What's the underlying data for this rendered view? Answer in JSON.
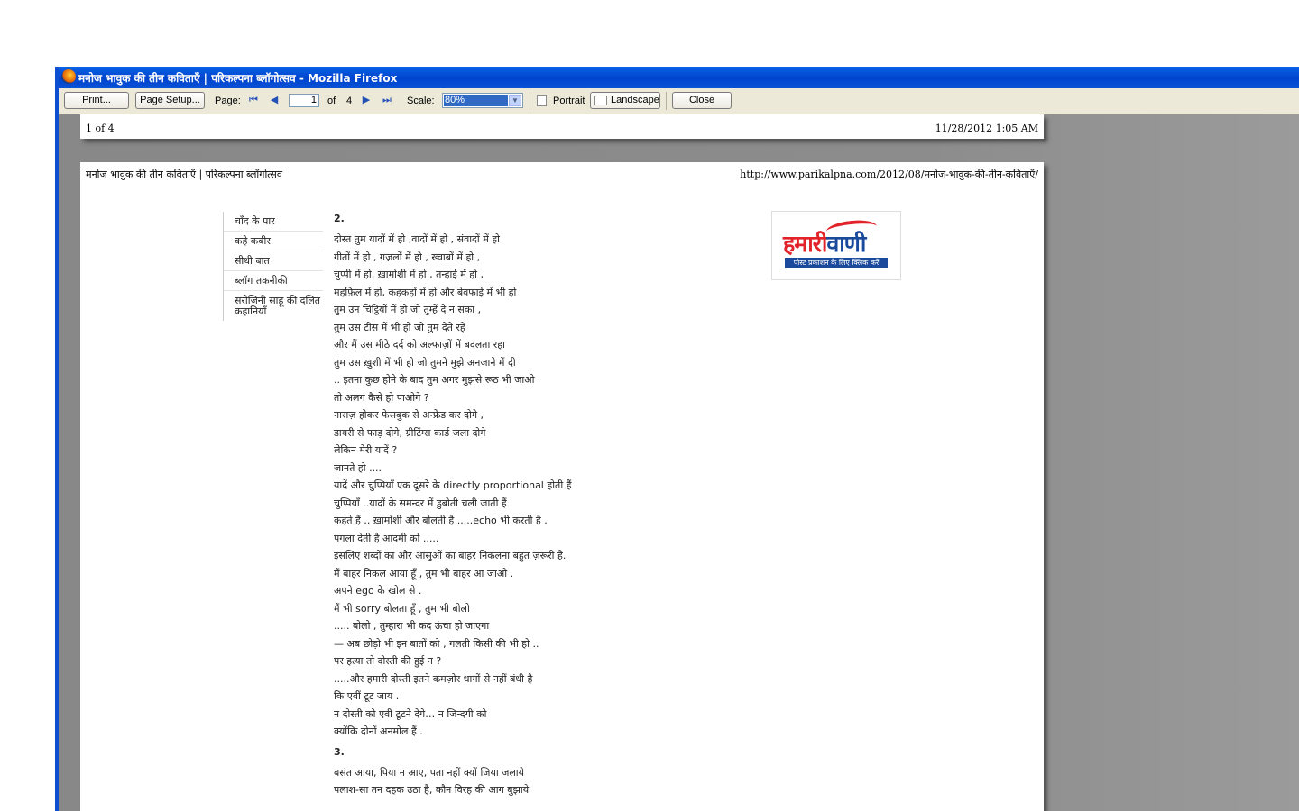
{
  "window": {
    "title": "मनोज भावुक की तीन कविताएँ | परिकल्पना ब्लॉगोत्सव - Mozilla Firefox"
  },
  "toolbar": {
    "print_label": "Print...",
    "page_setup_label": "Page Setup...",
    "page_label": "Page:",
    "page_value": "1",
    "of_label": "of",
    "page_total": "4",
    "scale_label": "Scale:",
    "scale_value": "80%",
    "portrait_label": "Portrait",
    "landscape_label": "Landscape",
    "close_label": "Close",
    "icons": [
      "first-page-icon",
      "previous-page-icon",
      "next-page-icon",
      "last-page-icon",
      "dropdown-arrow-icon",
      "portrait-icon",
      "landscape-icon"
    ]
  },
  "print_header": {
    "left": "1 of 4",
    "right": "11/28/2012 1:05 AM"
  },
  "page": {
    "title": "मनोज भावुक की तीन कविताएँ | परिकल्पना ब्लॉगोत्सव",
    "url": "http://www.parikalpna.com/2012/08/मनोज-भावुक-की-तीन-कविताएँ/",
    "sidebar": [
      {
        "label": "चाँद के पार"
      },
      {
        "label": "कहे कबीर"
      },
      {
        "label": "सीधी बात"
      },
      {
        "label": "ब्लॉग तकनीकी"
      },
      {
        "label": "सरोजिनी साहू की दलित कहानियाँ"
      }
    ],
    "poem_2_number": "2.",
    "poem_2_lines": [
      "दोस्त तुम यादों में हो ,वादों में हो , संवादों में हो",
      "गीतों में हो , ग़ज़लों में हो , ख्वाबों में हो ,",
      "चुप्पी में हो, ख़ामोशी में हो , तन्हाई में हो ,",
      "महफ़िल में हो, कहकहों में हो और बेवफाई में भी हो",
      "तुम उन चिट्ठियों में हो जो तुम्हें दे न सका ,",
      "तुम उस टीस में भी हो जो तुम देते रहे",
      "और मैं उस मीठे दर्द को अल्फाज़ों में बदलता रहा",
      "तुम उस ख़ुशी में भी हो जो तुमने मुझे अनजाने में दी",
      ".. इतना कुछ होने के बाद तुम अगर मुझसे रूठ भी जाओ",
      "तो अलग कैसे हो पाओगे ?",
      "नाराज़ होकर फेसबुक से अन्फ्रेंड कर दोगे ,",
      "डायरी से फाड़ दोगे, ग्रीटिंग्स कार्ड जला दोगे",
      "लेकिन मेरी यादें ?",
      "जानते हो ....",
      "यादें और चुप्पियाँ एक दूसरे के directly proportional होती हैं",
      "चुप्पियाँ ..यादों के समन्दर में डुबोती चली जाती हैं",
      "कहते हैं .. ख़ामोशी और बोलती है .....echo भी करती है .",
      "पगला देती है आदमी को .....",
      "इसलिए शब्दों का और आंसुओं का बाहर निकलना बहुत ज़रूरी है.",
      "मैं बाहर निकल आया हूँ , तुम भी बाहर आ जाओ .",
      "अपने ego के खोल से .",
      "मैं भी sorry बोलता हूँ , तुम भी बोलो",
      "..... बोलो , तुम्हारा भी कद ऊंचा हो जाएगा",
      "— अब छोड़ो भी इन बातों को , गलती किसी की भी हो ..",
      "पर हत्या तो दोस्ती की हुई न ?",
      ".....और हमारी दोस्ती इतने कमज़ोर धागों से नहीं बंधी है",
      "कि एवीं टूट जाय .",
      "न दोस्ती को एवीं टूटने देंगे… न जिन्दगी को",
      "क्योंकि दोनों अनमोल हैं ."
    ],
    "poem_3_number": "3.",
    "poem_3_lines": [
      "बसंत आया, पिया न आए, पता नहीं क्यों जिया जलाये",
      "पलाश-सा तन दहक उठा है, कौन विरह की आग बुझाये"
    ],
    "ad": {
      "logo_part1": "हमारी",
      "logo_part2": "वाणी",
      "tagline": "पोस्ट प्रकाशन के लिए क्लिक करें",
      "colors": {
        "red": "#e2232a",
        "blue": "#1b4a9c"
      }
    }
  }
}
